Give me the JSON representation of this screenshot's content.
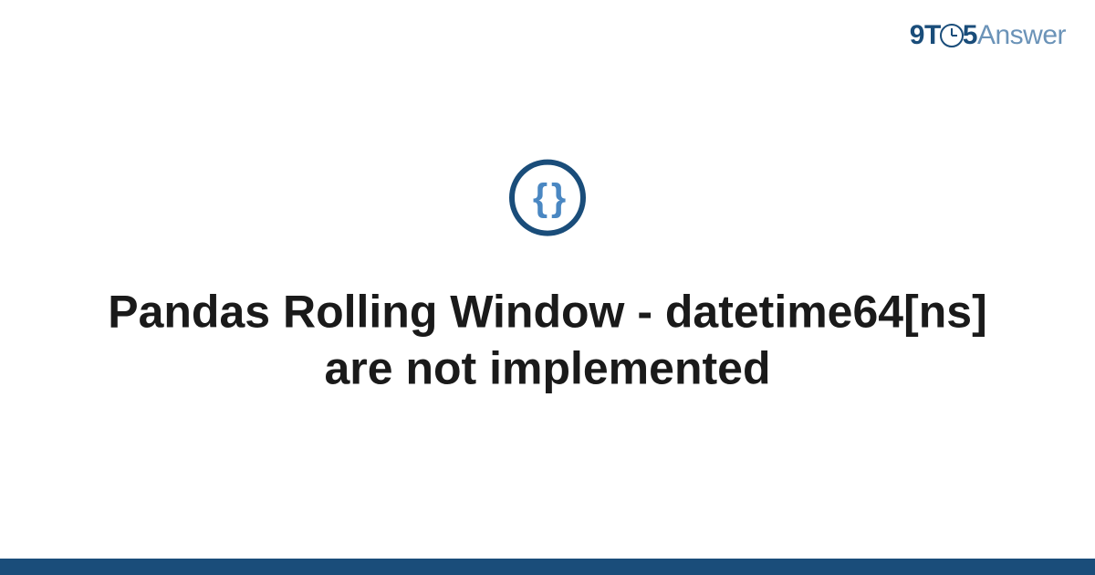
{
  "logo": {
    "nine": "9",
    "t": "T",
    "five": "5",
    "answer": "Answer"
  },
  "icon": {
    "braces": "{ }"
  },
  "main": {
    "title": "Pandas Rolling Window - datetime64[ns] are not implemented"
  },
  "colors": {
    "brand_dark": "#1a4d7a",
    "brand_light": "#6b93b8",
    "brace_blue": "#4a87c2"
  }
}
